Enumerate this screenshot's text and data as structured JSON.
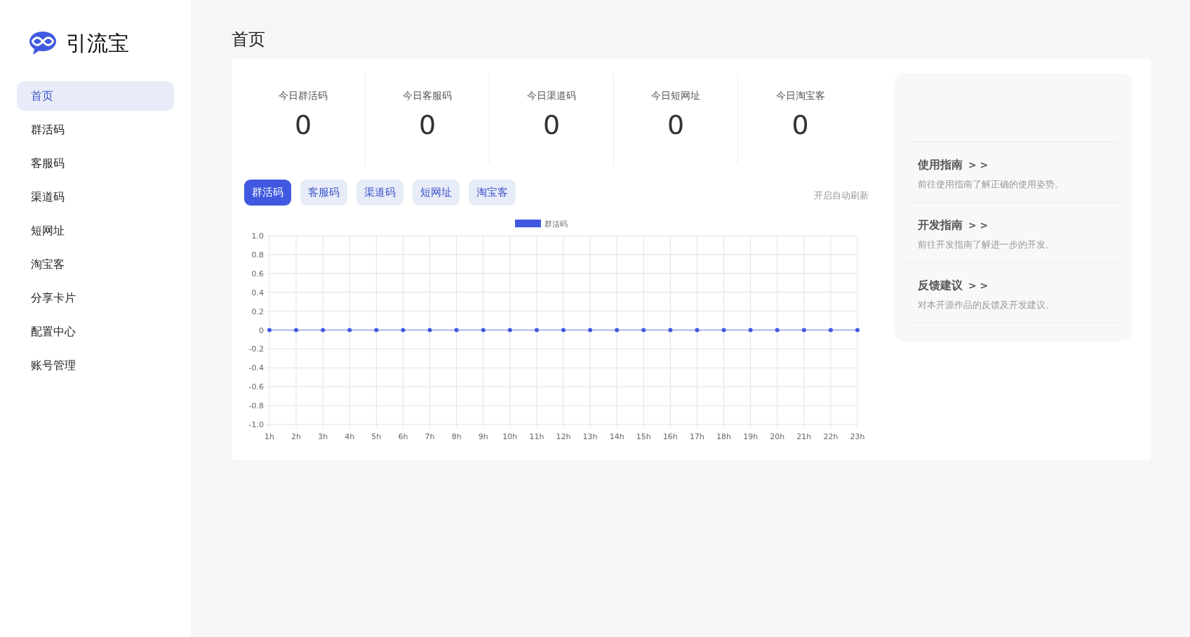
{
  "brand": {
    "name": "引流宝"
  },
  "sidebar": {
    "items": [
      {
        "label": "首页",
        "selected": true
      },
      {
        "label": "群活码",
        "selected": false
      },
      {
        "label": "客服码",
        "selected": false
      },
      {
        "label": "渠道码",
        "selected": false
      },
      {
        "label": "短网址",
        "selected": false
      },
      {
        "label": "淘宝客",
        "selected": false
      },
      {
        "label": "分享卡片",
        "selected": false
      },
      {
        "label": "配置中心",
        "selected": false
      },
      {
        "label": "账号管理",
        "selected": false
      }
    ]
  },
  "page": {
    "title": "首页"
  },
  "stats": [
    {
      "label": "今日群活码",
      "value": "0"
    },
    {
      "label": "今日客服码",
      "value": "0"
    },
    {
      "label": "今日渠道码",
      "value": "0"
    },
    {
      "label": "今日短网址",
      "value": "0"
    },
    {
      "label": "今日淘宝客",
      "value": "0"
    }
  ],
  "tabs": [
    {
      "label": "群活码",
      "selected": true
    },
    {
      "label": "客服码",
      "selected": false
    },
    {
      "label": "渠道码",
      "selected": false
    },
    {
      "label": "短网址",
      "selected": false
    },
    {
      "label": "淘宝客",
      "selected": false
    }
  ],
  "auto_refresh": {
    "label": "开启自动刷新"
  },
  "chart": {
    "chart_data": {
      "type": "line",
      "categories": [
        "1h",
        "2h",
        "3h",
        "4h",
        "5h",
        "6h",
        "7h",
        "8h",
        "9h",
        "10h",
        "11h",
        "12h",
        "13h",
        "14h",
        "15h",
        "16h",
        "17h",
        "18h",
        "19h",
        "20h",
        "21h",
        "22h",
        "23h"
      ],
      "grid": true,
      "series": [
        {
          "name": "群活码",
          "color": "#4059e0",
          "marker": "circle",
          "values": [
            0,
            0,
            0,
            0,
            0,
            0,
            0,
            0,
            0,
            0,
            0,
            0,
            0,
            0,
            0,
            0,
            0,
            0,
            0,
            0,
            0,
            0,
            0
          ]
        }
      ],
      "ylim": [
        -1,
        1
      ],
      "yticks": [
        {
          "value": 1,
          "label": "1.0"
        },
        {
          "value": 0.8,
          "label": "0.8"
        },
        {
          "value": 0.6,
          "label": "0.6"
        },
        {
          "value": 0.4,
          "label": "0.4"
        },
        {
          "value": 0.2,
          "label": "0.2"
        },
        {
          "value": 0,
          "label": "0"
        },
        {
          "value": -0.2,
          "label": "-0.2"
        },
        {
          "value": -0.4,
          "label": "-0.4"
        },
        {
          "value": -0.6,
          "label": "-0.6"
        },
        {
          "value": -0.8,
          "label": "-0.8"
        },
        {
          "value": -1,
          "label": "-1.0"
        }
      ]
    }
  },
  "guides": [
    {
      "title": "使用指南",
      "arrow": "> >",
      "description": "前往使用指南了解正确的使用姿势。"
    },
    {
      "title": "开发指南",
      "arrow": "> >",
      "description": "前往开发指南了解进一步的开发。"
    },
    {
      "title": "反馈建议",
      "arrow": "> >",
      "description": "对本开源作品的反馈及开发建议。"
    }
  ]
}
